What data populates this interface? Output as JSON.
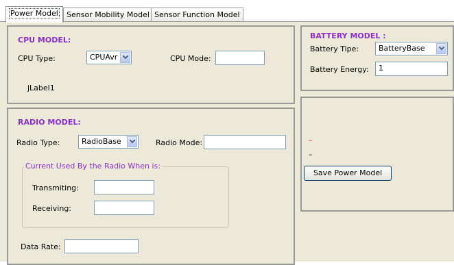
{
  "tabs": [
    {
      "label": "Power Model",
      "active": true
    },
    {
      "label": "Sensor Mobility Model",
      "active": false
    },
    {
      "label": "Sensor Function Model",
      "active": false
    }
  ],
  "cpu": {
    "title": "CPU MODEL:",
    "type_label": "CPU Type:",
    "type_value": "CPUAvr",
    "mode_label": "CPU Mode:",
    "mode_value": "",
    "jlabel": "jLabel1"
  },
  "battery": {
    "title": "BATTERY MODEL :",
    "type_label": "Battery Tipe:",
    "type_value": "BatteryBase",
    "energy_label": "Battery Energy:",
    "energy_value": "1"
  },
  "radio": {
    "title": "RADIO MODEL:",
    "type_label": "Radio Type:",
    "type_value": "RadioBase",
    "mode_label": "Radio Mode:",
    "mode_value": "",
    "current_legend": "Current Used By the Radio When is:",
    "transmitting_label": "Transmiting:",
    "transmitting_value": "",
    "receiving_label": "Receiving:",
    "receiving_value": "",
    "data_rate_label": "Data Rate:",
    "data_rate_value": ""
  },
  "save": {
    "marker_red": "–",
    "marker_black": "–",
    "button_label": "Save Power Model"
  },
  "colors": {
    "title_purple": "#8b2fc9",
    "panel_bg": "#ece9d8",
    "field_border": "#7f9db9"
  }
}
